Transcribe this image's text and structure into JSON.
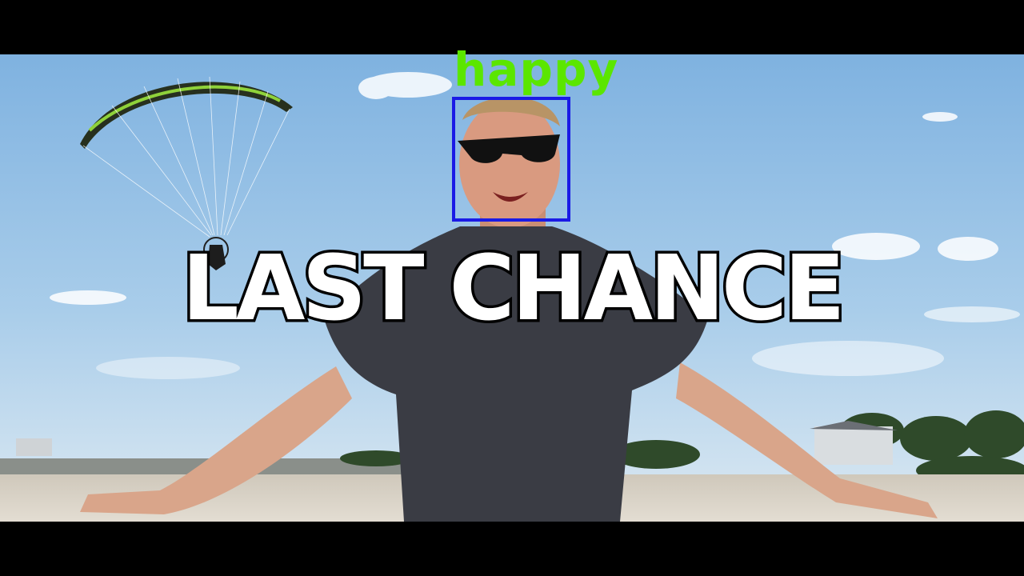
{
  "video": {
    "title_text": "LAST CHANCE"
  },
  "face_detection": {
    "emotion_label": "happy",
    "box_color": "#1a1ae6",
    "label_color": "#5be600"
  },
  "colors": {
    "sky": "#9ec8ea",
    "sand": "#d8d2c6",
    "shirt": "#3a3c44"
  }
}
